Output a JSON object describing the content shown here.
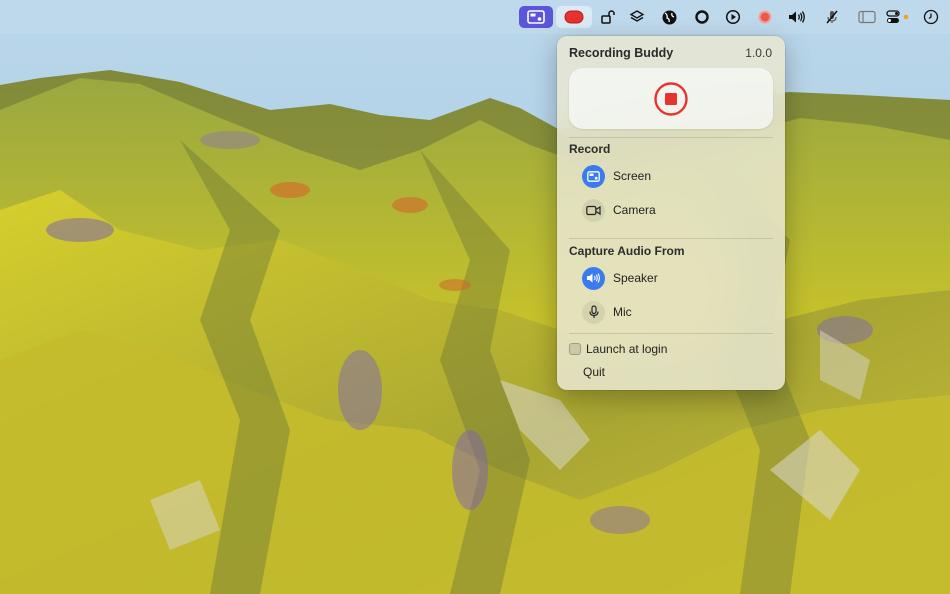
{
  "menubar": {
    "items": [
      {
        "icon": "screen-record-app-icon"
      },
      {
        "icon": "record-app-icon",
        "color": "#e8322f"
      },
      {
        "icon": "lock-open-icon"
      },
      {
        "icon": "layers-icon"
      },
      {
        "icon": "globe-icon"
      },
      {
        "icon": "circle-icon"
      },
      {
        "icon": "play-circle-icon"
      },
      {
        "icon": "record-dot-icon"
      },
      {
        "icon": "speaker-icon"
      },
      {
        "icon": "mic-muted-icon"
      },
      {
        "icon": "sidebar-icon"
      },
      {
        "icon": "control-center-icon"
      },
      {
        "icon": "clock-icon"
      }
    ]
  },
  "popover": {
    "title": "Recording Buddy",
    "version": "1.0.0",
    "stop_button": {
      "icon": "stop-record-icon",
      "color": "#e8322f"
    },
    "record_section": {
      "title": "Record",
      "items": [
        {
          "label": "Screen",
          "icon": "screen-icon",
          "active": true
        },
        {
          "label": "Camera",
          "icon": "camera-icon",
          "active": false
        }
      ]
    },
    "audio_section": {
      "title": "Capture Audio From",
      "items": [
        {
          "label": "Speaker",
          "icon": "speaker-icon",
          "active": true
        },
        {
          "label": "Mic",
          "icon": "mic-icon",
          "active": false
        }
      ]
    },
    "launch_at_login": {
      "label": "Launch at login",
      "checked": false
    },
    "quit_label": "Quit"
  },
  "colors": {
    "accent": "#3a7bf0",
    "record_red": "#e8322f",
    "menubar_active": "#5b55d9"
  }
}
